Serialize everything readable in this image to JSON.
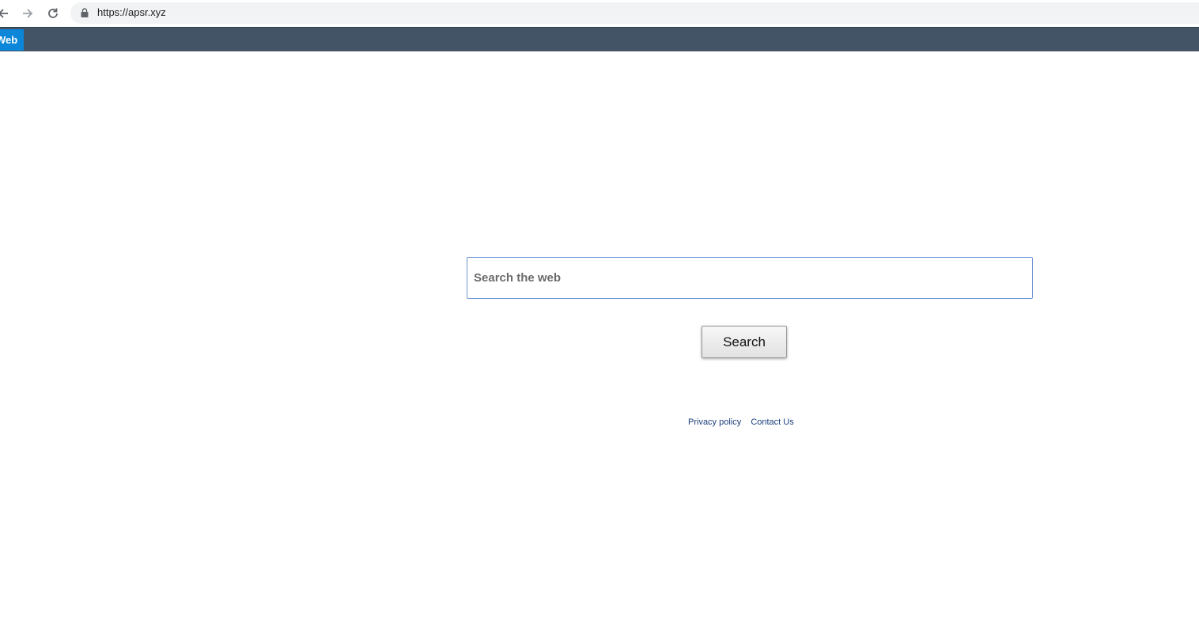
{
  "browser": {
    "url": "https://apsr.xyz",
    "back_icon": "arrow-left-icon",
    "forward_icon": "arrow-right-icon",
    "reload_icon": "reload-icon",
    "lock_icon": "lock-icon"
  },
  "nav": {
    "tab_label": "Web",
    "bar_color": "#425466",
    "tab_color": "#0b86d8"
  },
  "search": {
    "placeholder": "Search the web",
    "value": "",
    "button_label": "Search"
  },
  "footer": {
    "privacy_label": "Privacy policy",
    "contact_label": "Contact Us"
  }
}
